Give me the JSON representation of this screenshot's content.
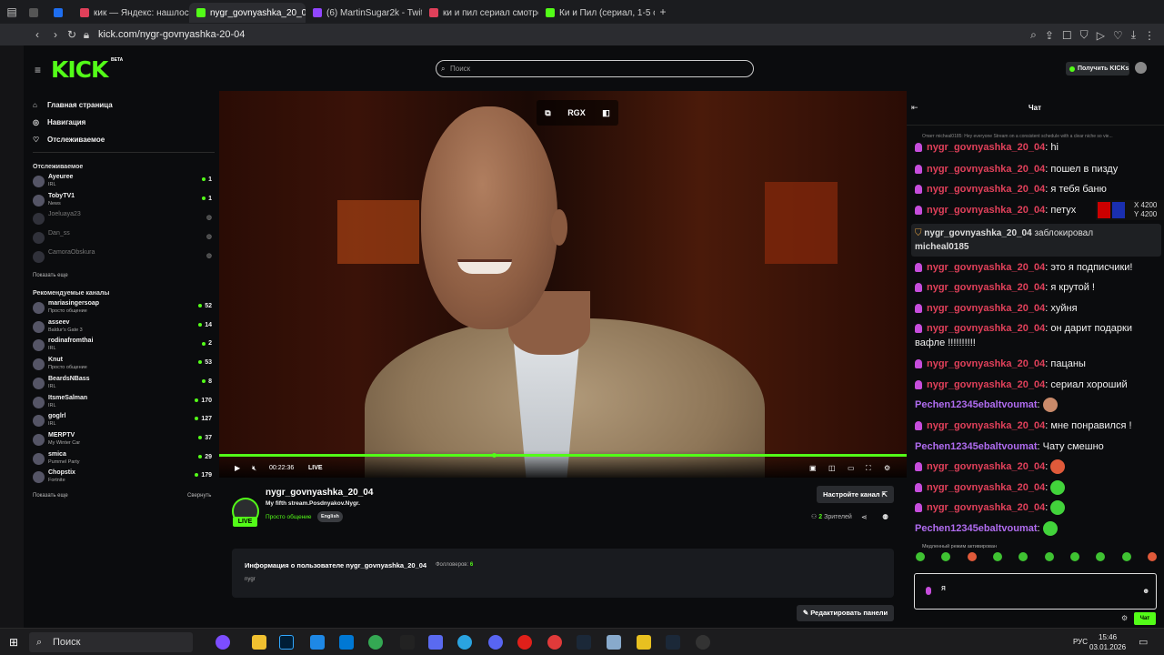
{
  "browser": {
    "tabs": [
      {
        "label": "",
        "color": "#555"
      },
      {
        "label": "",
        "color": "#1e6ef0"
      },
      {
        "label": "кик — Яндекс: нашлось 7",
        "color": "#e0405a"
      },
      {
        "label": "nygr_govnyashka_20_04",
        "color": "#53fc18",
        "active": true
      },
      {
        "label": "(6) MartinSugar2k - Twitch",
        "color": "#9146ff"
      },
      {
        "label": "ки и пил сериал смотреть",
        "color": "#e0405a"
      },
      {
        "label": "Ки и Пил (сериал, 1-5 сезон)",
        "color": "#53fc18"
      }
    ],
    "new_tab": "+",
    "url": "kick.com/nygr-govnyashka-20-04"
  },
  "header": {
    "logo": "KICK",
    "beta": "BETA",
    "search_placeholder": "Поиск",
    "get_kicks": "Получить KICKs"
  },
  "sidebar": {
    "nav": [
      {
        "icon": "⌂",
        "label": "Главная страница"
      },
      {
        "icon": "◎",
        "label": "Навигация"
      },
      {
        "icon": "♡",
        "label": "Отслеживаемое"
      }
    ],
    "followed_title": "Отслеживаемое",
    "followed": [
      {
        "name": "Ayeuree",
        "cat": "IRL",
        "viewers": "1",
        "live": true
      },
      {
        "name": "TobyTV1",
        "cat": "News",
        "viewers": "1",
        "live": true
      },
      {
        "name": "Joeluaya23",
        "cat": "",
        "viewers": "◍",
        "live": false
      },
      {
        "name": "Dan_ss",
        "cat": "",
        "viewers": "◍",
        "live": false
      },
      {
        "name": "CamoraObskura",
        "cat": "",
        "viewers": "◍",
        "live": false
      }
    ],
    "show_more": "Показать еще",
    "recommended_title": "Рекомендуемые каналы",
    "recommended": [
      {
        "name": "mariasingersoap",
        "cat": "Просто общение",
        "viewers": "52"
      },
      {
        "name": "asseev",
        "cat": "Baldur's Gate 3",
        "viewers": "14"
      },
      {
        "name": "rodinafromthai",
        "cat": "IRL",
        "viewers": "2"
      },
      {
        "name": "Knut",
        "cat": "Просто общение",
        "viewers": "53"
      },
      {
        "name": "BeardsNBass",
        "cat": "IRL",
        "viewers": "8"
      },
      {
        "name": "ItsmeSalman",
        "cat": "IRL",
        "viewers": "170"
      },
      {
        "name": "goglrl",
        "cat": "IRL",
        "viewers": "127"
      },
      {
        "name": "MERPTV",
        "cat": "My Winter Car",
        "viewers": "37"
      },
      {
        "name": "smica",
        "cat": "Pummel Party",
        "viewers": "29"
      },
      {
        "name": "Chopstix",
        "cat": "Fortnite",
        "viewers": "179"
      }
    ],
    "show_more2": "Показать еще",
    "collapse": "Свернуть"
  },
  "video": {
    "top_label": "RGX",
    "time": "00:22:36",
    "live": "LIVE"
  },
  "channel": {
    "name": "nygr_govnyashka_20_04",
    "title": "My fifth stream.Posdnyakov.Nygr.",
    "category": "Просто общение",
    "language": "English",
    "live_badge": "LIVE",
    "setup_button": "Настройте канал",
    "viewers_count": "2",
    "viewers_label": "Зрителей",
    "about_title": "Информация о пользователе nygr_govnyashka_20_04",
    "followers_label": "Фолловеров:",
    "followers_count": "6",
    "about_body": "nygr",
    "edit_panels": "Редактировать панели"
  },
  "chat": {
    "title": "Чат",
    "reply_line": "Ответ micheal0185: Hey everyone Stream on a consistent schedule with a clear niche so vie...",
    "messages": [
      {
        "user": "nygr_govnyashka_20_04",
        "text": "hi"
      },
      {
        "user": "nygr_govnyashka_20_04",
        "text": "пошел в пизду"
      },
      {
        "user": "nygr_govnyashka_20_04",
        "text": "я тебя баню"
      },
      {
        "user": "nygr_govnyashka_20_04",
        "text": "петух"
      }
    ],
    "ban_user": "nygr_govnyashka_20_04",
    "ban_text": "заблокировал",
    "ban_target": "micheal0185",
    "messages2": [
      {
        "user": "nygr_govnyashka_20_04",
        "text": "это я подписчики!"
      },
      {
        "user": "nygr_govnyashka_20_04",
        "text": "я крутой !"
      },
      {
        "user": "nygr_govnyashka_20_04",
        "text": "хуйня"
      },
      {
        "user": "nygr_govnyashka_20_04",
        "text": "он дарит подарки"
      },
      {
        "user": "",
        "text": "вафле !!!!!!!!!!"
      },
      {
        "user": "nygr_govnyashka_20_04",
        "text": "пацаны"
      },
      {
        "user": "nygr_govnyashka_20_04",
        "text": "сериал хороший"
      }
    ],
    "msg_pech1": "Pechen12345ebaltvoumat",
    "msg_ny_like": "мне понравился !",
    "msg_pech2_text": "Чату смешно",
    "slow_mode": "Медленный режим активирован",
    "input_value": "я",
    "send_button": "Чат",
    "overlay_x": "X 4200",
    "overlay_y": "Y 4200"
  },
  "taskbar": {
    "search": "Поиск",
    "lang": "РУС",
    "time": "15:46",
    "date": "03.01.2026"
  }
}
